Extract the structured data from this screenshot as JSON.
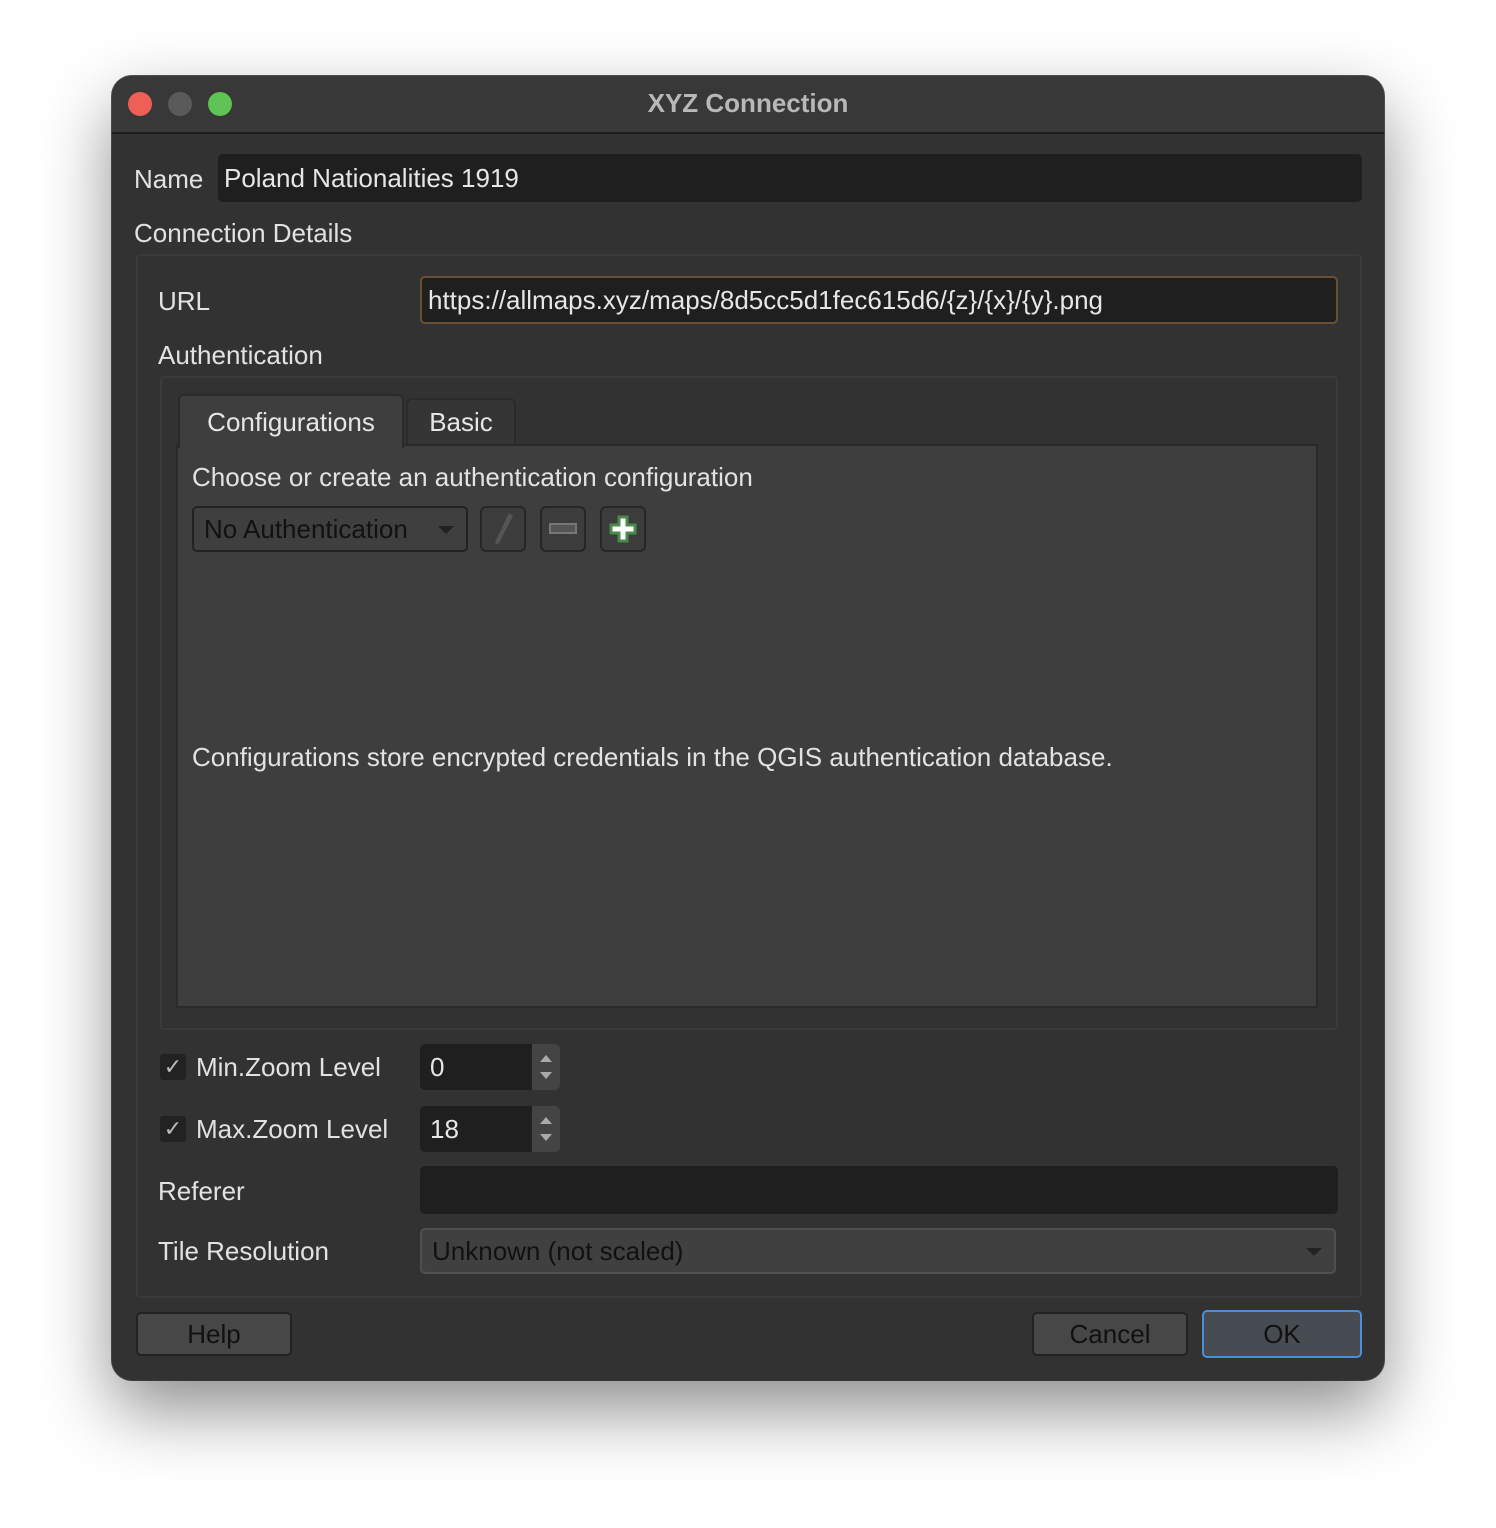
{
  "window": {
    "title": "XYZ Connection",
    "traffic_lights": {
      "close": "#ee5f57",
      "minimize": "#5a5a5a",
      "zoom": "#5fc453"
    }
  },
  "name": {
    "label": "Name",
    "value": "Poland Nationalities 1919"
  },
  "connection_details": {
    "heading": "Connection Details",
    "url": {
      "label": "URL",
      "value": "https://allmaps.xyz/maps/8d5cc5d1fec615d6/{z}/{x}/{y}.png",
      "focus_color": "#6b4f33"
    },
    "authentication": {
      "heading": "Authentication",
      "tabs": [
        {
          "label": "Configurations",
          "active": true
        },
        {
          "label": "Basic",
          "active": false
        }
      ],
      "prompt": "Choose or create an authentication configuration",
      "config_select": {
        "value": "No Authentication"
      },
      "icons": [
        "pencil-icon",
        "minus-icon",
        "plus-icon"
      ],
      "note": "Configurations store encrypted credentials in the QGIS authentication database."
    },
    "min_zoom": {
      "label": "Min.Zoom Level",
      "checked": true,
      "value": "0"
    },
    "max_zoom": {
      "label": "Max.Zoom Level",
      "checked": true,
      "value": "18"
    },
    "referer": {
      "label": "Referer",
      "value": ""
    },
    "tile_resolution": {
      "label": "Tile Resolution",
      "value": "Unknown (not scaled)"
    }
  },
  "buttons": {
    "help": "Help",
    "cancel": "Cancel",
    "ok": "OK",
    "ok_focus_color": "#4a90d9"
  }
}
